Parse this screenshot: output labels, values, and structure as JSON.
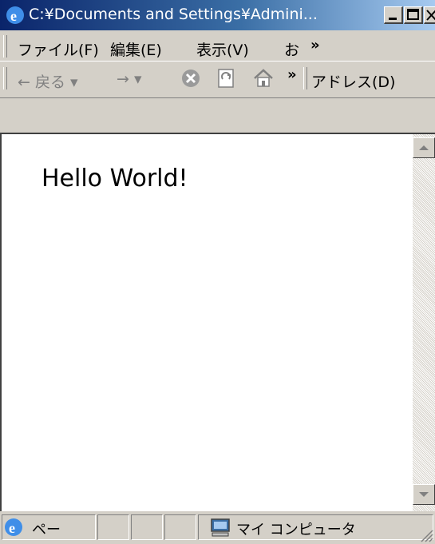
{
  "window": {
    "title": "C:¥Documents and Settings¥Admini...",
    "colors": {
      "titlebar_start": "#0a246a",
      "titlebar_end": "#a6caf0",
      "chrome": "#d4d0c8"
    }
  },
  "menu": {
    "file": "ファイル(F)",
    "edit": "編集(E)",
    "view": "表示(V)",
    "favorites": "お",
    "more": "»"
  },
  "toolbar": {
    "back": "← 戻る ▾",
    "forward": "→ ▾",
    "more": "»",
    "address_label": "アドレス(D)"
  },
  "content": {
    "text": "Hello World!"
  },
  "status": {
    "text": "ペー",
    "zone": "マイ コンピュータ"
  },
  "icons": [
    "ie-icon",
    "minimize-icon",
    "maximize-icon",
    "close-icon",
    "windows-logo-icon",
    "stop-icon",
    "refresh-icon",
    "home-icon",
    "scroll-up-icon",
    "scroll-down-icon",
    "computer-icon",
    "size-grip-icon"
  ]
}
